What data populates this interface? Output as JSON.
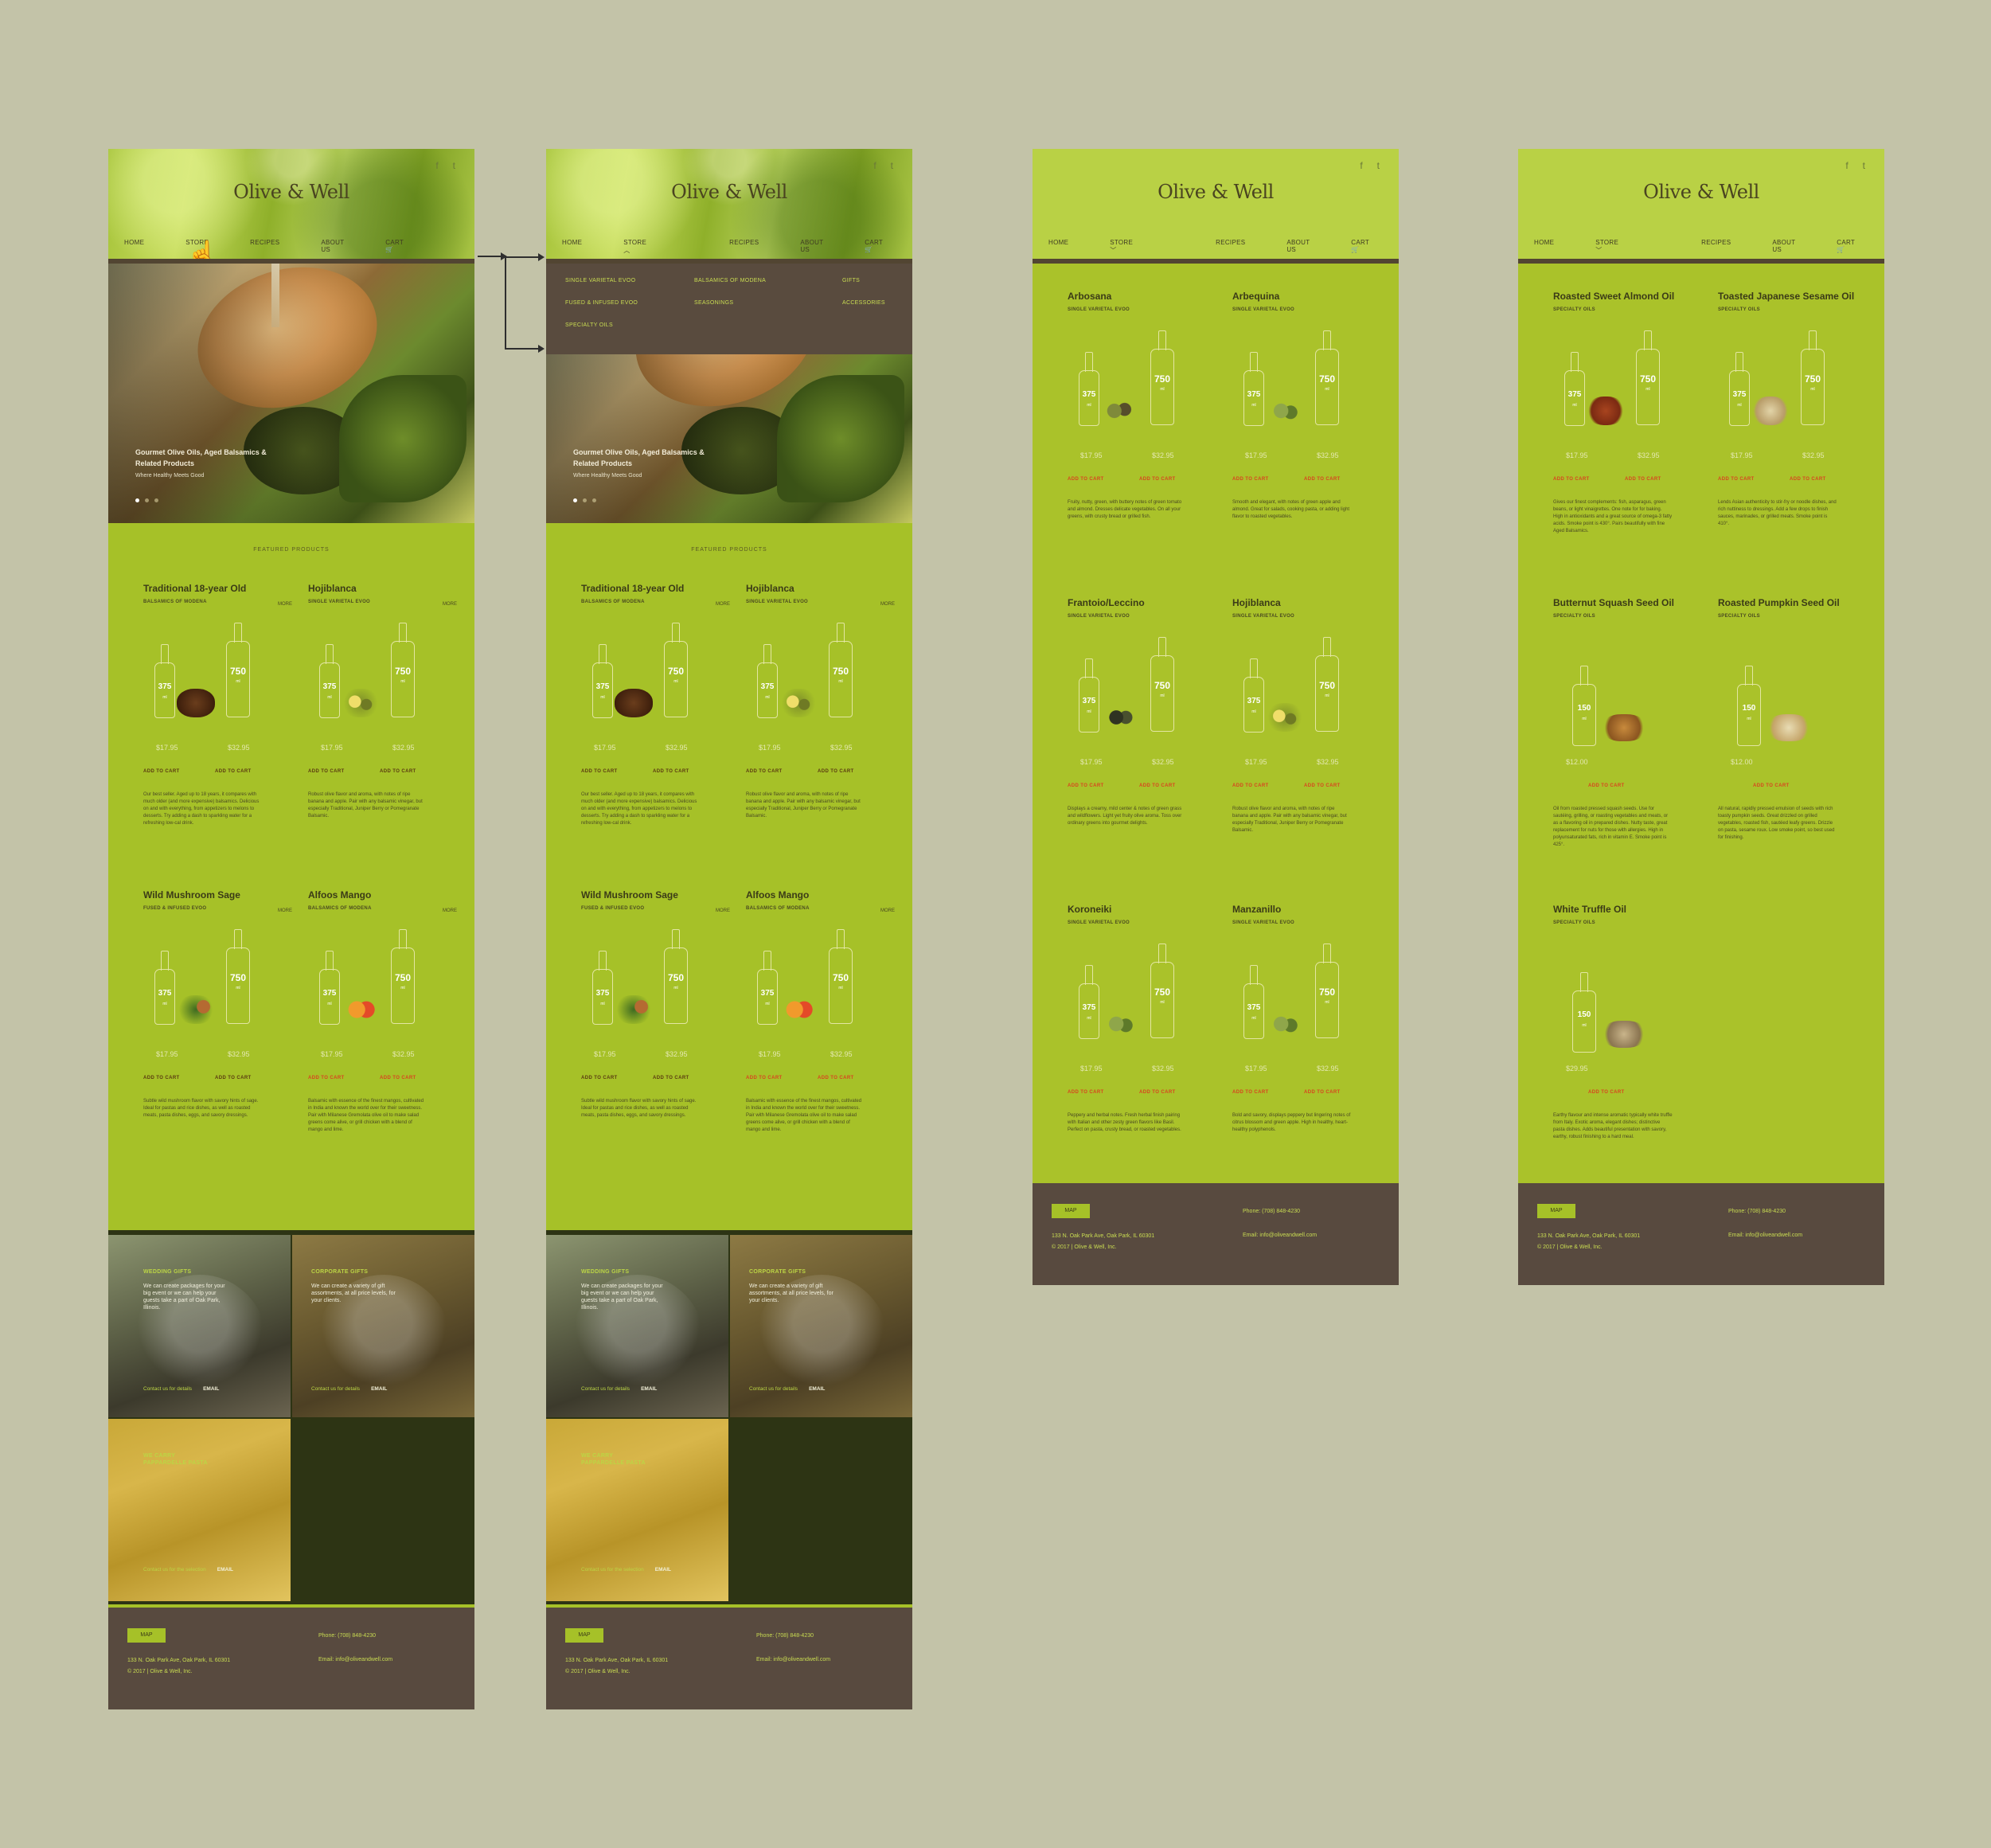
{
  "brand": "Olive & Well",
  "nav": {
    "home": "HOME",
    "store": "STORE",
    "recipes": "RECIPES",
    "about": "ABOUT US",
    "cart": "CART"
  },
  "social": {
    "facebook": "f",
    "twitter": "t"
  },
  "store_menu": [
    "SINGLE VARIETAL EVOO",
    "BALSAMICS OF MODENA",
    "GIFTS",
    "FUSED & INFUSED EVOO",
    "SEASONINGS",
    "ACCESSORIES",
    "SPECIALTY OILS"
  ],
  "hero": {
    "title": "Gourmet Olive Oils, Aged Balsamics & Related Products",
    "subtitle": "Where Healthy Meets Good"
  },
  "featured_title": "FEATURED PRODUCTS",
  "sizes": {
    "small": "375",
    "large": "750",
    "ml": "ml",
    "s150": "150"
  },
  "cart_label": "ADD TO CART",
  "more_label": "MORE",
  "featured": [
    {
      "name": "Traditional 18-year Old",
      "sub": "BALSAMICS OF MODENA",
      "p1": "$17.95",
      "p2": "$32.95",
      "desc": "Our best seller. Aged up to 18 years, it compares with much older (and more expensive) balsamics. Delicious on and with everything, from appetizers to melons to desserts. Try adding a dash to sparkling water for a refreshing low-cal drink."
    },
    {
      "name": "Hojiblanca",
      "sub": "SINGLE VARIETAL EVOO",
      "p1": "$17.95",
      "p2": "$32.95",
      "desc": "Robust olive flavor and aroma, with notes of ripe banana and apple. Pair with any balsamic vinegar, but especially Traditional, Juniper Berry or Pomegranate Balsamic."
    },
    {
      "name": "Wild Mushroom Sage",
      "sub": "FUSED & INFUSED EVOO",
      "p1": "$17.95",
      "p2": "$32.95",
      "desc": "Subtle wild mushroom flavor with savory hints of sage. Ideal for pastas and rice dishes, as well as roasted meats, pasta dishes, eggs, and savory dressings."
    },
    {
      "name": "Alfoos Mango",
      "sub": "BALSAMICS OF MODENA",
      "p1": "$17.95",
      "p2": "$32.95",
      "desc": "Balsamic with essence of the finest mangos, cultivated in India and known the world over for their sweetness. Pair with Milanese Gremolata olive oil to make salad greens come alive, or grill chicken with a blend of mango and lime."
    }
  ],
  "evoo": [
    {
      "name": "Arbosana",
      "sub": "SINGLE VARIETAL EVOO",
      "p1": "$17.95",
      "p2": "$32.95",
      "desc": "Fruity, nutty, green, with buttery notes of green tomato and almond. Dresses delicate vegetables. On all your greens, with crusty bread or grilled fish."
    },
    {
      "name": "Arbequina",
      "sub": "SINGLE VARIETAL EVOO",
      "p1": "$17.95",
      "p2": "$32.95",
      "desc": "Smooth and elegant, with notes of green apple and almond. Great for salads, cooking pasta, or adding light flavor to roasted vegetables."
    },
    {
      "name": "Frantoio/Leccino",
      "sub": "SINGLE VARIETAL EVOO",
      "p1": "$17.95",
      "p2": "$32.95",
      "desc": "Displays a creamy, mild center & notes of green grass and wildflowers. Light yet fruity olive aroma. Toss over ordinary greens into gourmet delights."
    },
    {
      "name": "Hojiblanca",
      "sub": "SINGLE VARIETAL EVOO",
      "p1": "$17.95",
      "p2": "$32.95",
      "desc": "Robust olive flavor and aroma, with notes of ripe banana and apple. Pair with any balsamic vinegar, but especially Traditional, Juniper Berry or Pomegranate Balsamic."
    },
    {
      "name": "Koroneiki",
      "sub": "SINGLE VARIETAL EVOO",
      "p1": "$17.95",
      "p2": "$32.95",
      "desc": "Peppery and herbal notes. Fresh herbal finish pairing with Italian and other zesty green flavors like Basil. Perfect on pasta, crusty bread, or roasted vegetables."
    },
    {
      "name": "Manzanillo",
      "sub": "SINGLE VARIETAL EVOO",
      "p1": "$17.95",
      "p2": "$32.95",
      "desc": "Bold and savory, displays peppery but lingering notes of citrus blossom and green apple. High in healthy, heart-healthy polyphenols."
    }
  ],
  "specialty": [
    {
      "name": "Roasted Sweet Almond Oil",
      "sub": "SPECIALTY OILS",
      "p1": "$17.95",
      "p2": "$32.95",
      "desc": "Gives our finest complements: fish, asparagus, green beans, or light vinaigrettes. One note for for baking. High in antioxidants and a great source of omega-3 fatty acids. Smoke point is 430°. Pairs beautifully with fine Aged Balsamics."
    },
    {
      "name": "Toasted Japanese Sesame Oil",
      "sub": "SPECIALTY OILS",
      "p1": "$17.95",
      "p2": "$32.95",
      "desc": "Lends Asian authenticity to stir-fry or noodle dishes, and rich nuttiness to dressings. Add a few drops to finish sauces, marinades, or grilled meats. Smoke point is 410°."
    },
    {
      "name": "Butternut Squash Seed Oil",
      "sub": "SPECIALTY OILS",
      "p1": "$12.00",
      "desc": "Oil from roasted pressed squash seeds. Use for sautéing, grilling, or roasting vegetables and meats, or as a flavoring oil in prepared dishes. Nutty taste, great replacement for nuts for those with allergies. High in polyunsaturated fats, rich in vitamin E. Smoke point is 425°."
    },
    {
      "name": "Roasted Pumpkin Seed Oil",
      "sub": "SPECIALTY OILS",
      "p1": "$12.00",
      "desc": "All natural, rapidly pressed emulsion of seeds with rich toasty pumpkin seeds. Great drizzled on grilled vegetables, roasted fish, sautéed leafy greens. Drizzle on pasta, sesame roux. Low smoke point, so best used for finishing."
    },
    {
      "name": "White Truffle Oil",
      "sub": "SPECIALTY OILS",
      "p1": "$29.95",
      "desc": "Earthy flavour and intense aromatic typically white truffle from Italy. Exotic aroma, elegant dishes; distinctive pasta dishes. Adds beautiful presentation with savory, earthy, robust finishing to a hard meal."
    }
  ],
  "gifts": [
    {
      "title": "WEDDING GIFTS",
      "desc": "We can create packages for your big event or we can help your guests take a part of Oak Park, Illinois.",
      "contact": "Contact us for details",
      "email": "EMAIL"
    },
    {
      "title": "CORPORATE GIFTS",
      "desc": "We can create a variety of gift assortments, at all price levels, for your clients.",
      "contact": "Contact us for details",
      "email": "EMAIL"
    },
    {
      "title": "WE CARRY PAPPARDELLE PASTA",
      "desc": "",
      "contact": "Contact us for the selection",
      "email": "EMAIL"
    }
  ],
  "footer": {
    "map": "MAP",
    "address": "133 N. Oak Park Ave, Oak Park, IL 60301",
    "copyright": "© 2017 | Olive & Well, Inc.",
    "phone": "Phone: (708) 848-4230",
    "email": "Email: info@oliveandwell.com"
  },
  "colors": {
    "background": "#c3c3a8",
    "green": "#a6c128",
    "dark": "#584a3f",
    "accent_red": "#d8451f"
  }
}
